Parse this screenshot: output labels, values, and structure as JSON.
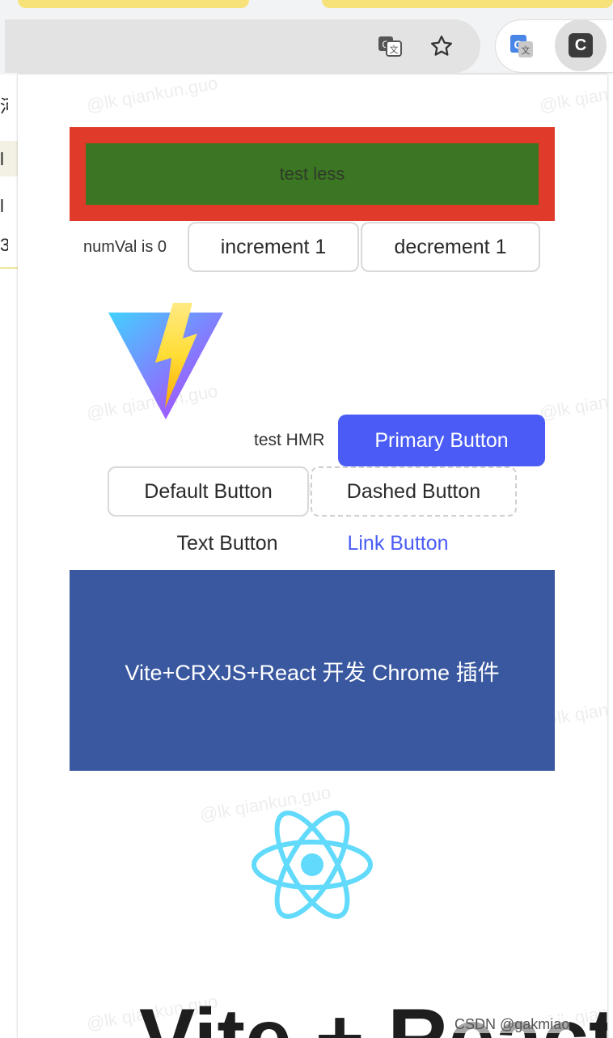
{
  "browser": {
    "translate_icon": "translate-icon",
    "bookmark_icon": "star-icon",
    "google_translate_ext_icon": "google-translate-icon",
    "crx_ext_letter": "C"
  },
  "bg_page": {
    "glyphs": [
      "河",
      "→",
      "l",
      "3"
    ]
  },
  "popup": {
    "watermark": "@lk qiankun.guo",
    "less_label": "test less",
    "num_label": "numVal is 0",
    "increment_label": "increment 1",
    "decrement_label": "decrement 1",
    "vite_logo": "vite-logo",
    "hmr_label": "test HMR",
    "primary_label": "Primary Button",
    "default_label": "Default Button",
    "dashed_label": "Dashed Button",
    "text_label": "Text Button",
    "link_label": "Link Button",
    "banner_text": "Vite+CRXJS+React 开发 Chrome 插件",
    "react_logo": "react-logo",
    "big_title": "Vite + React",
    "csdn": "CSDN @gakmiao"
  },
  "colors": {
    "less_outer": "#e03b2a",
    "less_inner": "#3b7722",
    "primary": "#4a5cf5",
    "banner": "#3a58a0",
    "react": "#61dafb"
  }
}
